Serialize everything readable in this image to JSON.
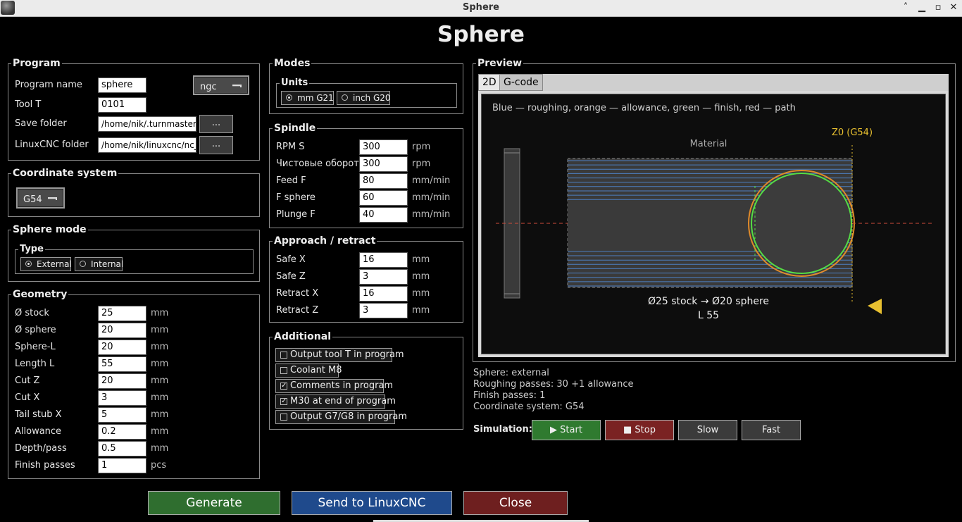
{
  "window": {
    "title": "Sphere"
  },
  "app": {
    "title": "Sphere"
  },
  "program": {
    "title": "Program",
    "name_label": "Program name",
    "name_value": "sphere",
    "ext_value": "ngc",
    "tool_label": "Tool T",
    "tool_value": "0101",
    "save_label": "Save folder",
    "save_value": "/home/nik/.turnmaster/ge",
    "linuxcnc_label": "LinuxCNC folder",
    "linuxcnc_value": "/home/nik/linuxcnc/nc_fil",
    "browse_label": "..."
  },
  "coord": {
    "title": "Coordinate system",
    "value": "G54"
  },
  "sphere_mode": {
    "title": "Sphere mode",
    "type_title": "Type",
    "external": "External",
    "internal": "Internal"
  },
  "geometry": {
    "title": "Geometry",
    "rows": [
      {
        "label": "Ø stock",
        "value": "25",
        "unit": "mm"
      },
      {
        "label": "Ø sphere",
        "value": "20",
        "unit": "mm"
      },
      {
        "label": "Sphere-L",
        "value": "20",
        "unit": "mm"
      },
      {
        "label": "Length L",
        "value": "55",
        "unit": "mm"
      },
      {
        "label": "Cut Z",
        "value": "20",
        "unit": "mm"
      },
      {
        "label": "Cut X",
        "value": "3",
        "unit": "mm"
      },
      {
        "label": "Tail stub X",
        "value": "5",
        "unit": "mm"
      },
      {
        "label": "Allowance",
        "value": "0.2",
        "unit": "mm"
      },
      {
        "label": "Depth/pass",
        "value": "0.5",
        "unit": "mm"
      },
      {
        "label": "Finish passes",
        "value": "1",
        "unit": "pcs"
      }
    ]
  },
  "modes": {
    "title": "Modes",
    "units_title": "Units",
    "mm": "mm G21",
    "inch": "inch G20"
  },
  "spindle": {
    "title": "Spindle",
    "rows": [
      {
        "label": "RPM S",
        "value": "300",
        "unit": "rpm"
      },
      {
        "label": "Чистовые обороты",
        "value": "300",
        "unit": "rpm"
      },
      {
        "label": "Feed F",
        "value": "80",
        "unit": "mm/min"
      },
      {
        "label": "F sphere",
        "value": "60",
        "unit": "mm/min"
      },
      {
        "label": "Plunge F",
        "value": "40",
        "unit": "mm/min"
      }
    ]
  },
  "approach": {
    "title": "Approach / retract",
    "rows": [
      {
        "label": "Safe X",
        "value": "16",
        "unit": "mm"
      },
      {
        "label": "Safe Z",
        "value": "3",
        "unit": "mm"
      },
      {
        "label": "Retract X",
        "value": "16",
        "unit": "mm"
      },
      {
        "label": "Retract Z",
        "value": "3",
        "unit": "mm"
      }
    ]
  },
  "additional": {
    "title": "Additional",
    "items": [
      {
        "label": "Output tool T in program",
        "checked": false
      },
      {
        "label": "Coolant M8",
        "checked": false
      },
      {
        "label": "Comments in program",
        "checked": true
      },
      {
        "label": "M30 at end of program",
        "checked": true
      },
      {
        "label": "Output G7/G8 in program",
        "checked": false
      }
    ]
  },
  "preview": {
    "title": "Preview",
    "tabs": [
      "2D",
      "G-code"
    ],
    "legend": "Blue — roughing, orange — allowance, green — finish, red — path",
    "material_label": "Material",
    "z0_label": "Z0 (G54)",
    "dims_line1": "Ø25 stock  →  Ø20 sphere",
    "dims_line2": "L 55",
    "roughing_passes": 30,
    "colors": {
      "roughing": "#4d7fc2",
      "allowance": "#e08a2a",
      "finish": "#55dd44",
      "path": "#d04a3a",
      "z0": "#e8c030"
    }
  },
  "info": {
    "line1": "Sphere: external",
    "line2": "Roughing passes: 30  +1 allowance",
    "line3": "Finish passes: 1",
    "line4": "Coordinate system: G54"
  },
  "simulation": {
    "label": "Simulation:",
    "start": "▶ Start",
    "stop": "■ Stop",
    "slow": "Slow",
    "fast": "Fast"
  },
  "actions": {
    "generate": "Generate",
    "send": "Send to LinuxCNC",
    "close": "Close"
  }
}
